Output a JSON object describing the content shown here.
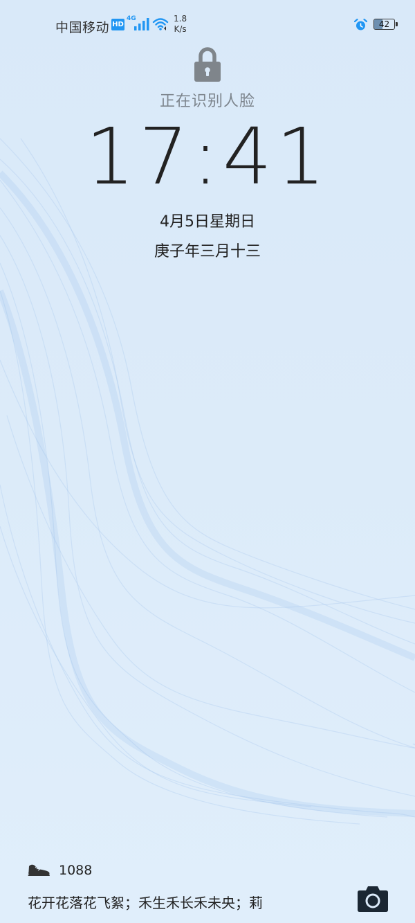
{
  "status_bar": {
    "carrier": "中国移动",
    "hd_badge": "HD",
    "network_type": "4G",
    "speed_value": "1.8",
    "speed_unit": "K/s",
    "battery_level": "42",
    "signal_icon": "cellular-signal-icon",
    "wifi_icon": "wifi-icon",
    "alarm_icon": "alarm-clock-icon",
    "accent_color": "#2196f3"
  },
  "lock_screen": {
    "lock_icon": "padlock-icon",
    "status_text": "正在识别人脸",
    "time": "17:41",
    "date": "4月5日星期日",
    "lunar_date": "庚子年三月十三"
  },
  "footer": {
    "step_icon": "shoe-icon",
    "step_count": "1088",
    "marquee_text": "花开花落花飞絮；禾生禾长禾未央；莉",
    "camera_icon": "camera-icon"
  }
}
